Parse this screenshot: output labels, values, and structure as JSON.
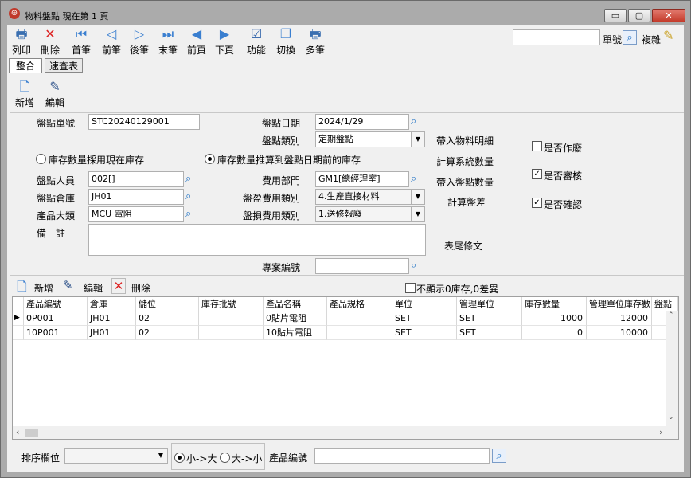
{
  "window": {
    "title": "物料盤點 現在第 1 頁",
    "app_icon": "globe-icon",
    "min": "▭",
    "max": "▢",
    "close": "✕"
  },
  "toolbar": {
    "items": [
      {
        "label": "列印",
        "icon": "printer-icon"
      },
      {
        "label": "刪除",
        "icon": "delete-icon"
      },
      {
        "label": "首筆",
        "icon": "first-record-icon"
      },
      {
        "label": "前筆",
        "icon": "prev-record-icon"
      },
      {
        "label": "後筆",
        "icon": "next-record-icon"
      },
      {
        "label": "末筆",
        "icon": "last-record-icon"
      },
      {
        "label": "前頁",
        "icon": "prev-page-icon"
      },
      {
        "label": "下頁",
        "icon": "next-page-icon"
      },
      {
        "label": "功能",
        "icon": "function-icon"
      },
      {
        "label": "切換",
        "icon": "switch-icon"
      },
      {
        "label": "多筆",
        "icon": "multi-record-icon"
      }
    ],
    "search_value": "",
    "search_label": "單號",
    "copy_label": "複雜"
  },
  "tabs": [
    {
      "label": "整合"
    },
    {
      "label": "速查表"
    }
  ],
  "actions": {
    "add": "新增",
    "edit": "編輯"
  },
  "form": {
    "doc_no_label": "盤點單號",
    "doc_no": "STC20240129001",
    "date_label": "盤點日期",
    "date": "2024/1/29",
    "type_label": "盤點類別",
    "type": "定期盤點",
    "radio_current": "庫存數量採用現在庫存",
    "radio_backdate": "庫存數量推算到盤點日期前的庫存",
    "person_label": "盤點人員",
    "person": "002[]",
    "dept_label": "費用部門",
    "dept": "GM1[總經理室]",
    "warehouse_label": "盤點倉庫",
    "warehouse": "JH01",
    "gain_label": "盤盈費用類別",
    "gain": "4.生產直接材料",
    "category_label": "產品大類",
    "category": "MCU 電阻",
    "loss_label": "盤損費用類別",
    "loss": "1.送修報廢",
    "remark_label": "備　註",
    "remark": "",
    "project_label": "專案編號",
    "project": ""
  },
  "side": {
    "import_detail": "帶入物料明細",
    "calc_system": "計算系統數量",
    "import_count": "帶入盤點數量",
    "calc_diff": "計算盤差",
    "footer_text": "表尾條文",
    "void_label": "是否作廢",
    "void": false,
    "review_label": "是否審核",
    "review": true,
    "confirm_label": "是否確認",
    "confirm": true
  },
  "detail_toolbar": {
    "add": "新增",
    "edit": "編輯",
    "delete": "刪除",
    "hide_zero": "不顯示0庫存,0差異",
    "hide_zero_checked": false
  },
  "table": {
    "columns": [
      "產品編號",
      "倉庫",
      "儲位",
      "庫存批號",
      "產品名稱",
      "產品規格",
      "單位",
      "管理單位",
      "庫存數量",
      "管理單位庫存數",
      "盤點"
    ],
    "rows": [
      [
        "0P001",
        "JH01",
        "02",
        "",
        "0貼片電阻",
        "",
        "SET",
        "SET",
        "1000",
        "12000",
        ""
      ],
      [
        "10P001",
        "JH01",
        "02",
        "",
        "10貼片電阻",
        "",
        "SET",
        "SET",
        "0",
        "10000",
        ""
      ]
    ]
  },
  "bottom": {
    "sort_label": "排序欄位",
    "sort_value": "",
    "asc": "小->大",
    "desc": "大->小",
    "product_no_label": "產品編號",
    "product_no": ""
  }
}
